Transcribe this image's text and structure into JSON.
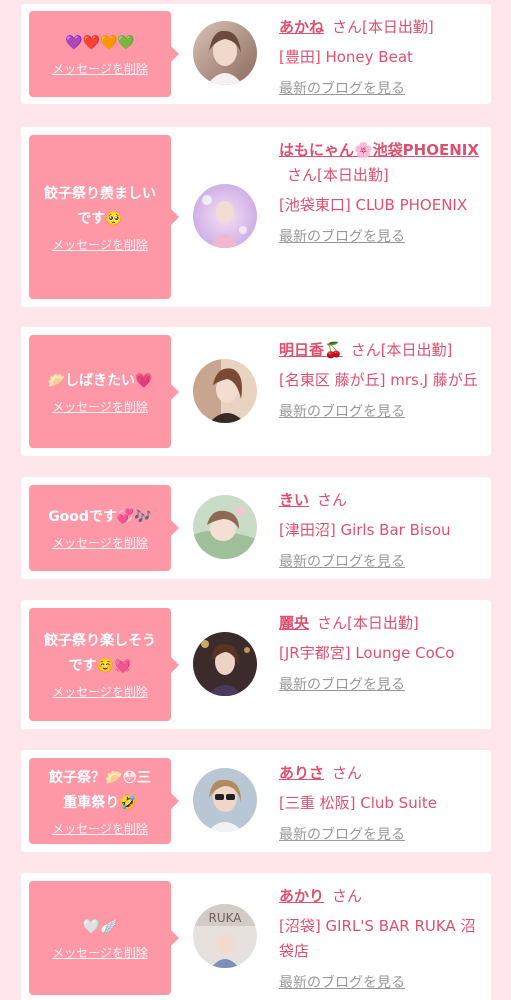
{
  "colors": {
    "background": "#ffe6ea",
    "card": "#ffffff",
    "bubble": "#fe97a6",
    "accent": "#e0506e",
    "link_gray": "#999999"
  },
  "messages": [
    {
      "text": "💜❤️🧡💚",
      "delete_label": "メッセージを削除",
      "name": "あかね",
      "status": "さん[本日出勤]",
      "shop": "[豊田] Honey Beat",
      "blog_label": "最新のブログを見る",
      "avatar_icon": "avatar-photo"
    },
    {
      "text": "餃子祭り羨ましい\nです🥺",
      "delete_label": "メッセージを削除",
      "name": "はもにゃん🌸池袋PHOENIX",
      "status": "さん[本日出勤]",
      "shop": "[池袋東口] CLUB PHOENIX",
      "blog_label": "最新のブログを見る",
      "avatar_icon": "avatar-photo"
    },
    {
      "text": "🥟しばきたい💗",
      "delete_label": "メッセージを削除",
      "name": "明日香🍒",
      "status": "さん[本日出勤]",
      "shop": "[名東区 藤が丘] mrs.J 藤が丘",
      "blog_label": "最新のブログを見る",
      "avatar_icon": "avatar-photo"
    },
    {
      "text": "Goodです💞🎶",
      "delete_label": "メッセージを削除",
      "name": "きい",
      "status": "さん",
      "shop": "[津田沼] Girls Bar Bisou",
      "blog_label": "最新のブログを見る",
      "avatar_icon": "avatar-photo"
    },
    {
      "text": "餃子祭り楽しそう\nです☺️💓",
      "delete_label": "メッセージを削除",
      "name": "麗央",
      "status": "さん[本日出勤]",
      "shop": "[JR宇都宮] Lounge CoCo",
      "blog_label": "最新のブログを見る",
      "avatar_icon": "avatar-photo"
    },
    {
      "text": "餃子祭？🥟😳三\n重車祭り🤣",
      "delete_label": "メッセージを削除",
      "name": "ありさ",
      "status": "さん",
      "shop": "[三重 松阪] Club Suite",
      "blog_label": "最新のブログを見る",
      "avatar_icon": "avatar-photo"
    },
    {
      "text": "🤍🪽",
      "delete_label": "メッセージを削除",
      "name": "あかり",
      "status": "さん",
      "shop": "[沼袋] GIRL'S BAR RUKA 沼袋店",
      "blog_label": "最新のブログを見る",
      "avatar_icon": "avatar-photo"
    }
  ]
}
